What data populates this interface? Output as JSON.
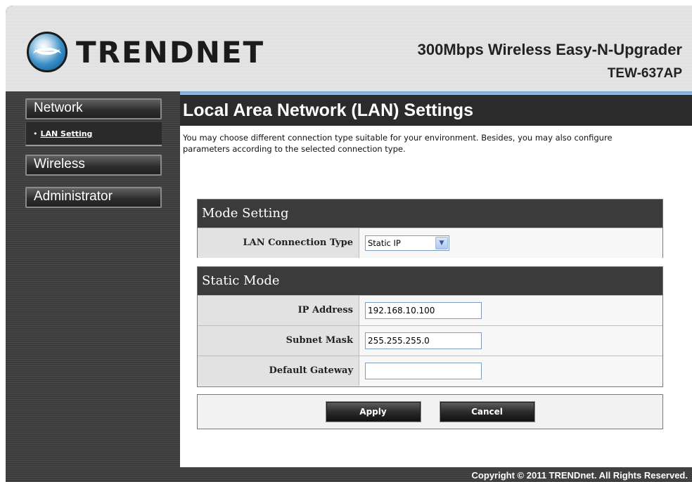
{
  "header": {
    "logo_text": "TRENDNET",
    "product_name": "300Mbps Wireless Easy-N-Upgrader",
    "model": "TEW-637AP"
  },
  "sidebar": {
    "items": [
      {
        "label": "Network",
        "expanded": true,
        "subitems": [
          {
            "label": "LAN Setting",
            "active": true
          }
        ]
      },
      {
        "label": "Wireless"
      },
      {
        "label": "Administrator"
      }
    ]
  },
  "main": {
    "title": "Local Area Network (LAN) Settings",
    "intro": "You may choose different connection type suitable for your environment. Besides, you may also configure parameters according to the selected connection type.",
    "mode_setting": {
      "heading": "Mode Setting",
      "connection_type_label": "LAN Connection Type",
      "connection_type_value": "Static IP"
    },
    "static_mode": {
      "heading": "Static Mode",
      "ip_label": "IP Address",
      "ip_value": "192.168.10.100",
      "mask_label": "Subnet Mask",
      "mask_value": "255.255.255.0",
      "gateway_label": "Default Gateway",
      "gateway_value": ""
    },
    "buttons": {
      "apply": "Apply",
      "cancel": "Cancel"
    }
  },
  "footer": {
    "copyright": "Copyright © 2011 TRENDnet. All Rights Reserved."
  },
  "colors": {
    "accent": "#6f9ed0",
    "dark_bar": "#2b2b2b"
  }
}
